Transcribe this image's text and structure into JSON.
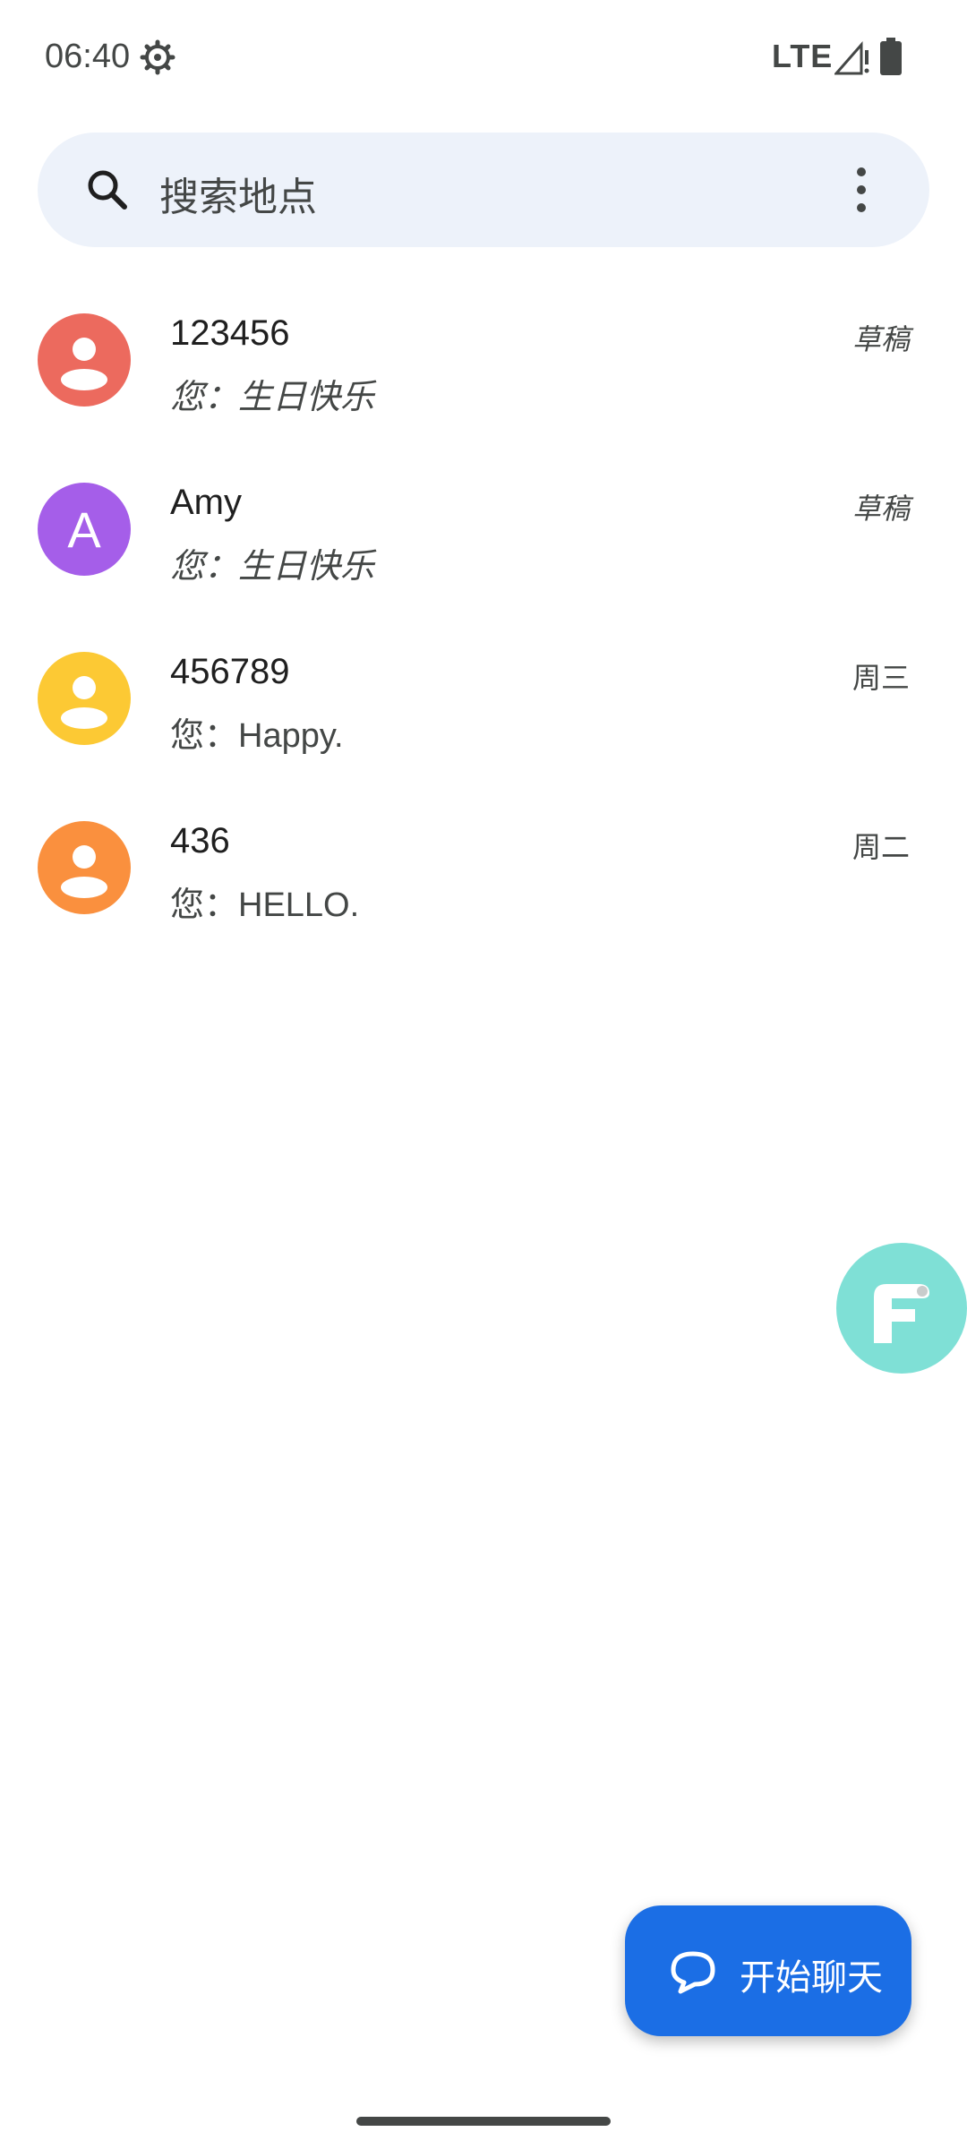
{
  "status_bar": {
    "time": "06:40",
    "network": "LTE",
    "icons": [
      "settings-gear-icon",
      "signal-icon",
      "battery-icon"
    ]
  },
  "search": {
    "placeholder": "搜索地点",
    "icon": "search-icon",
    "menu_icon": "more-vert-icon"
  },
  "conversations": [
    {
      "name": "123456",
      "preview": "您：生日快乐",
      "meta": "草稿",
      "is_draft": true,
      "avatar_type": "person",
      "avatar_color": "#ec6a5e"
    },
    {
      "name": "Amy",
      "preview": "您：生日快乐",
      "meta": "草稿",
      "is_draft": true,
      "avatar_type": "letter",
      "avatar_letter": "A",
      "avatar_color": "#a55ee9"
    },
    {
      "name": "456789",
      "preview": "您：Happy.",
      "meta": "周三",
      "is_draft": false,
      "avatar_type": "person",
      "avatar_color": "#fcc934"
    },
    {
      "name": "436",
      "preview": "您：HELLO.",
      "meta": "周二",
      "is_draft": false,
      "avatar_type": "person",
      "avatar_color": "#fa903e"
    }
  ],
  "floating_bubble": {
    "icon": "assistant-bubble-icon",
    "color": "#7fe0d6"
  },
  "fab": {
    "label": "开始聊天",
    "icon": "chat-bubble-icon",
    "color": "#1b6ee5"
  }
}
